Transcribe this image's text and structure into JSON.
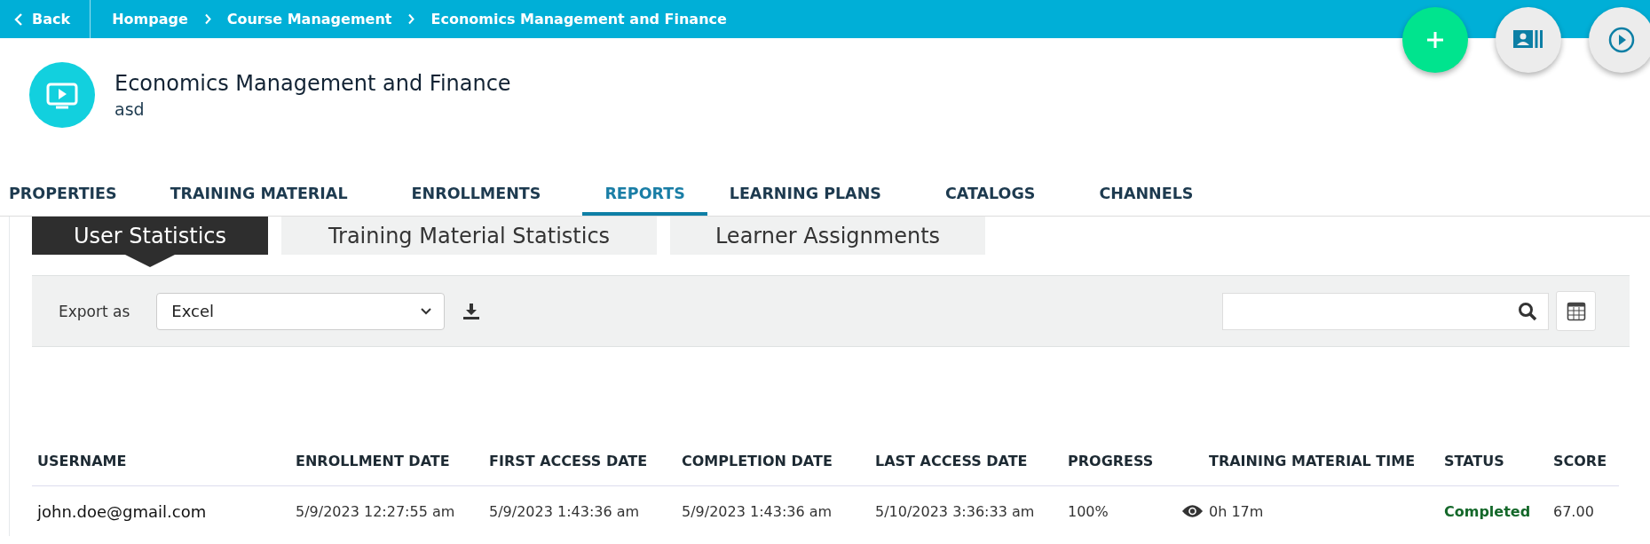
{
  "topbar": {
    "back": "Back",
    "breadcrumbs": [
      "Hompage",
      "Course Management",
      "Economics Management and Finance"
    ]
  },
  "course": {
    "title": "Economics Management and Finance",
    "subtitle": "asd"
  },
  "tabs": [
    {
      "label": "PROPERTIES",
      "selected": false
    },
    {
      "label": "TRAINING MATERIAL",
      "selected": false
    },
    {
      "label": "ENROLLMENTS",
      "selected": false
    },
    {
      "label": "REPORTS",
      "selected": true
    },
    {
      "label": "LEARNING PLANS",
      "selected": false
    },
    {
      "label": "CATALOGS",
      "selected": false
    },
    {
      "label": "CHANNELS",
      "selected": false
    }
  ],
  "subtabs": [
    {
      "label": "User Statistics",
      "selected": true
    },
    {
      "label": "Training Material Statistics",
      "selected": false
    },
    {
      "label": "Learner Assignments",
      "selected": false
    }
  ],
  "toolbar": {
    "export_label": "Export as",
    "export_value": "Excel"
  },
  "table": {
    "columns": [
      "USERNAME",
      "ENROLLMENT DATE",
      "FIRST ACCESS DATE",
      "COMPLETION DATE",
      "LAST ACCESS DATE",
      "PROGRESS",
      "TRAINING MATERIAL TIME",
      "STATUS",
      "SCORE"
    ],
    "rows": [
      {
        "cells": [
          "john.doe@gmail.com",
          "5/9/2023 12:27:55 am",
          "5/9/2023 1:43:36 am",
          "5/9/2023 1:43:36 am",
          "5/10/2023 3:36:33 am",
          "100%",
          "0h 17m",
          "Completed",
          "67.00"
        ]
      }
    ]
  }
}
